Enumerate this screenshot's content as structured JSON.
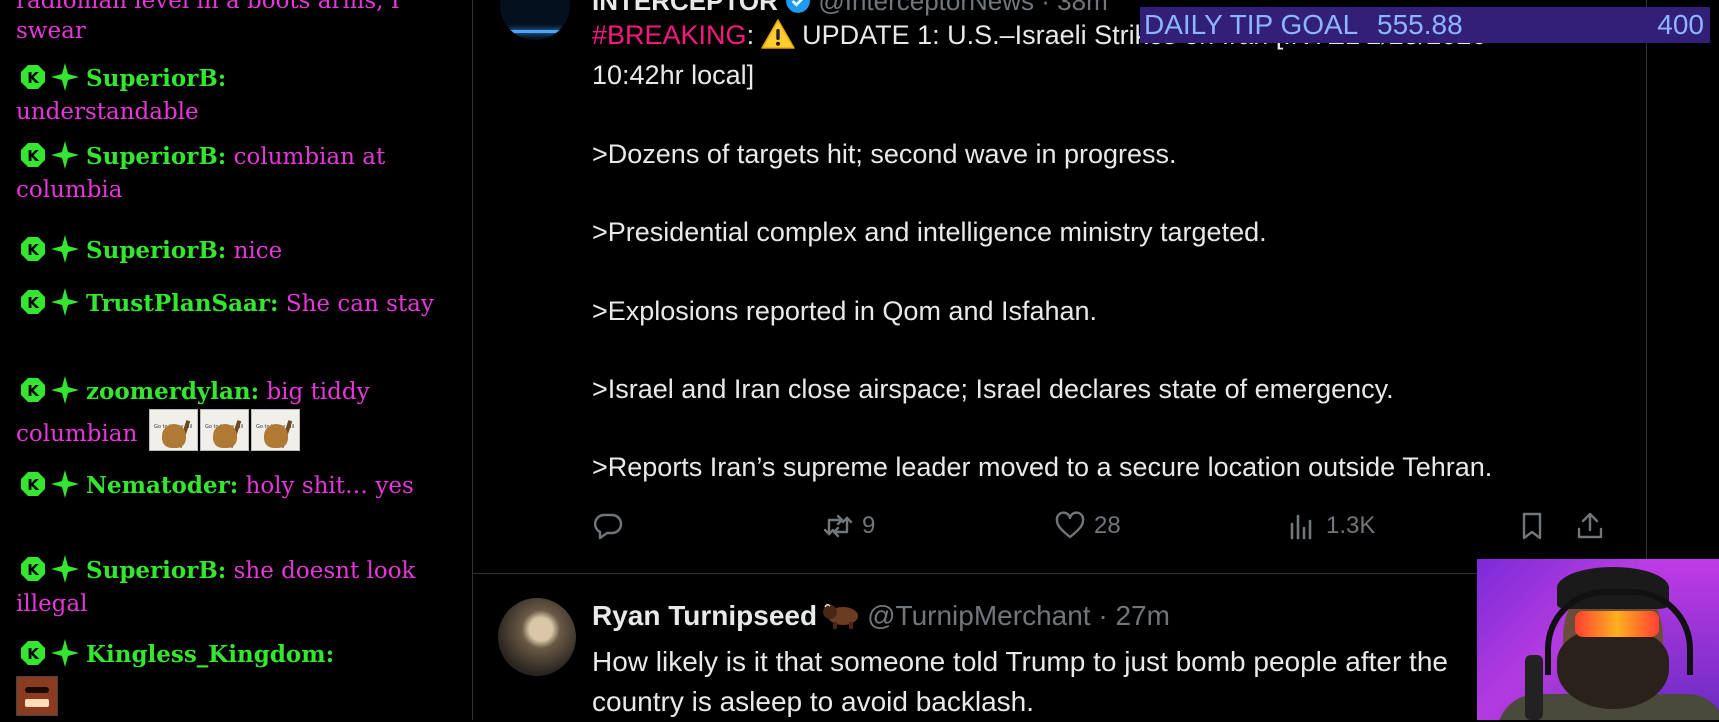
{
  "chat": {
    "top_partial": "radioman level in a boots arms, I swear",
    "messages": [
      {
        "user": "SuperiorB:",
        "text": "understandable"
      },
      {
        "user": "SuperiorB:",
        "text": "columbian at columbia"
      },
      {
        "user": "SuperiorB:",
        "text": "nice"
      },
      {
        "user": "TrustPlanSaar:",
        "text": "She can stay"
      },
      {
        "user": "zoomerdylan:",
        "text": "big tiddy columbian",
        "emote_caption": "Go to horny jail"
      },
      {
        "user": "Nematoder:",
        "text": "holy shit… yes"
      },
      {
        "user": "SuperiorB:",
        "text": "she doesnt look illegal"
      },
      {
        "user": "Kingless_Kingdom:",
        "text": ""
      }
    ],
    "colors": {
      "username": "#34e62f",
      "message": "#e637d8",
      "badge": "#34e62f"
    }
  },
  "tweet": {
    "author_partial": "INTERCEPTOR",
    "handle_partial": "@InterceptorNews · 38m",
    "breaking_tag": "#BREAKING",
    "headline": "UPDATE 1: U.S.–Israeli Strikes on Iran [INTEL 2/28/2026",
    "headline_cont": "10:42hr local]",
    "lines": [
      ">Dozens of targets hit; second wave in progress.",
      ">Presidential complex and intelligence ministry targeted.",
      ">Explosions reported in Qom and Isfahan.",
      ">Israel and Iran close airspace; Israel declares state of emergency.",
      ">Reports Iran’s supreme leader moved to a secure location outside Tehran."
    ],
    "actions": {
      "retweets": "9",
      "likes": "28",
      "views": "1.3K"
    }
  },
  "reply": {
    "name": "Ryan Turnipseed",
    "handle": "@TurnipMerchant · 27m",
    "text": "How likely is it that someone told Trump to just bomb people after the country is asleep to avoid backlash."
  },
  "tip_goal": {
    "label": "DAILY TIP GOAL",
    "amount": "555.88",
    "goal": "400",
    "bg_color": "#322078",
    "text_color": "#8fb4ff"
  }
}
